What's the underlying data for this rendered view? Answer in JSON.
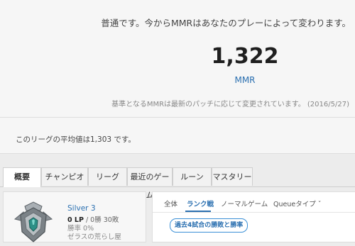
{
  "mmr": {
    "message": "普通です。今からMMRはあなたのプレーによって変わります。",
    "value": "1,322",
    "label": "MMR",
    "note": "基準となるMMRは最新のパッチに応じて変更されています。 (2016/5/27)"
  },
  "average": {
    "text": "このリーグの平均値は1,303 です。"
  },
  "tabs": [
    "概要",
    "チャンピオン",
    "リーグ",
    "最近のゲーム",
    "ルーン",
    "マスタリー"
  ],
  "profile": {
    "tier": "Silver 3",
    "lp": "0 LP",
    "record": " / 0勝 30敗",
    "winrate": "勝率 0%",
    "league": "ゼラスの荒らし屋",
    "emblem_icon": "silver-tier-emblem"
  },
  "filters": {
    "all": "全体",
    "ranked": "ランク戦",
    "normal": "ノーマルゲーム",
    "queue": "Queueタイプ ˇ"
  },
  "recent_button": "過去4試合の勝敗と勝率",
  "colors": {
    "accent": "#2a6fb0",
    "background": "#ececec"
  }
}
